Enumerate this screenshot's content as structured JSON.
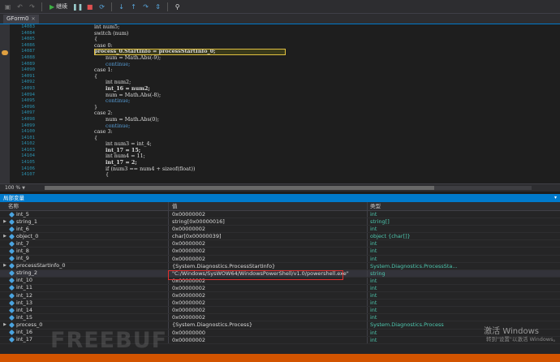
{
  "toolbar": {
    "continue_label": "继续"
  },
  "tab": {
    "label": "GForm0",
    "close": "✕"
  },
  "editor": {
    "line_numbers": [
      "14083",
      "14084",
      "14085",
      "14086",
      "14087",
      "14088",
      "14089",
      "14090",
      "14091",
      "14092",
      "14093",
      "14094",
      "14095",
      "14096",
      "14097",
      "14098",
      "14099",
      "14100",
      "14101",
      "14102",
      "14103",
      "14104",
      "14105",
      "14106",
      "14107"
    ],
    "lines": [
      "int num5;",
      "switch (num)",
      "{",
      "case 0:",
      "process_0.StartInfo = processStartInfo_0;",
      "num = Math.Abs(-9);",
      "continue;",
      "case 1:",
      "{",
      "int num2;",
      "int_16 = num2;",
      "num = Math.Abs(-8);",
      "continue;",
      "}",
      "case 2:",
      "num = Math.Abs(0);",
      "continue;",
      "case 3:",
      "{",
      "int num3 = int_4;",
      "int_17 = 15;",
      "int num4 = 11;",
      "int_17 = 2;",
      "if (num3 == num4 + sizeof(float))",
      "{"
    ]
  },
  "zoom": {
    "value": "100 %"
  },
  "locals": {
    "title": "局部变量",
    "headers": {
      "name": "名称",
      "value": "值",
      "type": "类型"
    },
    "rows": [
      {
        "name": "int_5",
        "value": "0x00000002",
        "type": "int",
        "expand": ""
      },
      {
        "name": "string_1",
        "value": "string[0x00000016]",
        "type": "string[]",
        "expand": "▶"
      },
      {
        "name": "int_6",
        "value": "0x00000002",
        "type": "int",
        "expand": ""
      },
      {
        "name": "object_0",
        "value": "char[0x00000039]",
        "type": "object {char[]}",
        "expand": "▶"
      },
      {
        "name": "int_7",
        "value": "0x00000002",
        "type": "int",
        "expand": ""
      },
      {
        "name": "int_8",
        "value": "0x00000002",
        "type": "int",
        "expand": ""
      },
      {
        "name": "int_9",
        "value": "0x00000002",
        "type": "int",
        "expand": ""
      },
      {
        "name": "processStartInfo_0",
        "value": "{System.Diagnostics.ProcessStartInfo}",
        "type": "System.Diagnostics.ProcessSta...",
        "expand": "▶"
      },
      {
        "name": "string_2",
        "value": "\"C:/Windows/SysWOW64/WindowsPowerShell/v1.0/powershell.exe\"",
        "type": "string",
        "expand": ""
      },
      {
        "name": "int_10",
        "value": "0x00000002",
        "type": "int",
        "expand": ""
      },
      {
        "name": "int_11",
        "value": "0x00000002",
        "type": "int",
        "expand": ""
      },
      {
        "name": "int_12",
        "value": "0x00000002",
        "type": "int",
        "expand": ""
      },
      {
        "name": "int_13",
        "value": "0x00000002",
        "type": "int",
        "expand": ""
      },
      {
        "name": "int_14",
        "value": "0x00000002",
        "type": "int",
        "expand": ""
      },
      {
        "name": "int_15",
        "value": "0x00000002",
        "type": "int",
        "expand": ""
      },
      {
        "name": "process_0",
        "value": "{System.Diagnostics.Process}",
        "type": "System.Diagnostics.Process",
        "expand": "▶"
      },
      {
        "name": "int_16",
        "value": "0x00000000",
        "type": "int",
        "expand": ""
      },
      {
        "name": "int_17",
        "value": "0x00000002",
        "type": "int",
        "expand": ""
      }
    ]
  },
  "watermark": {
    "line1": "激活 Windows",
    "line2": "转到\"设置\"以激活 Windows。"
  },
  "brand": {
    "text": "FREEBUF"
  },
  "colors": {
    "accent": "#007acc",
    "highlight_box": "#e03030",
    "bottom_bar": "#d35400"
  }
}
